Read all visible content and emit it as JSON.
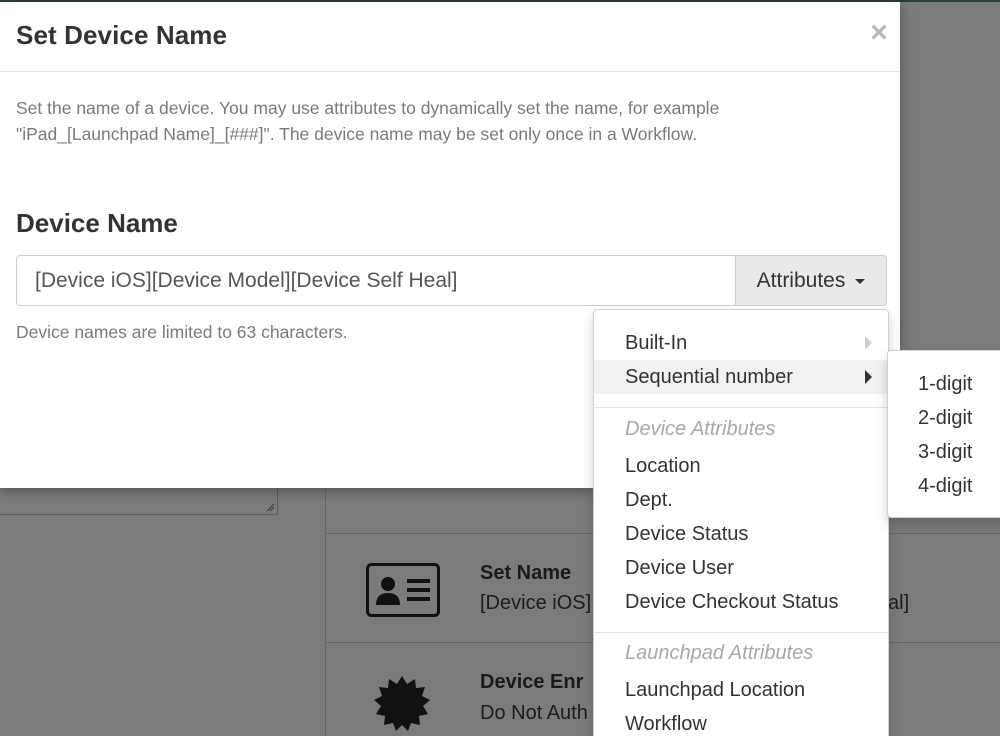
{
  "modal": {
    "title": "Set Device Name",
    "close_label": "×",
    "description": "Set the name of a device. You may use attributes to dynamically set the name, for example \"iPad_[Launchpad Name]_[###]\". The device name may be set only once in a Workflow.",
    "field_label": "Device Name",
    "input_value": "[Device iOS][Device Model][Device Self Heal]",
    "attributes_button": "Attributes",
    "help_text": "Device names are limited to 63 characters."
  },
  "dropdown": {
    "items_top": [
      {
        "label": "Built-In",
        "has_submenu": true
      },
      {
        "label": "Sequential number",
        "has_submenu": true,
        "active": true
      }
    ],
    "device_header": "Device Attributes",
    "device_items": [
      "Location",
      "Dept.",
      "Device Status",
      "Device User",
      "Device Checkout Status"
    ],
    "launchpad_header": "Launchpad Attributes",
    "launchpad_items": [
      "Launchpad Location",
      "Workflow"
    ]
  },
  "submenu": {
    "items": [
      "1-digit",
      "2-digit",
      "3-digit",
      "4-digit"
    ]
  },
  "background": {
    "row1_title": "Set Name",
    "row1_sub_left": "[Device iOS]",
    "row1_sub_right": "al]",
    "row2_title": "Device Enr",
    "row2_sub": "Do Not Auth"
  },
  "colors": {
    "overlay": "#7b7b7b",
    "menu_active_bg": "#f2f2f2",
    "muted_text": "#7a7a7a",
    "header_text": "#a8a8a8"
  }
}
